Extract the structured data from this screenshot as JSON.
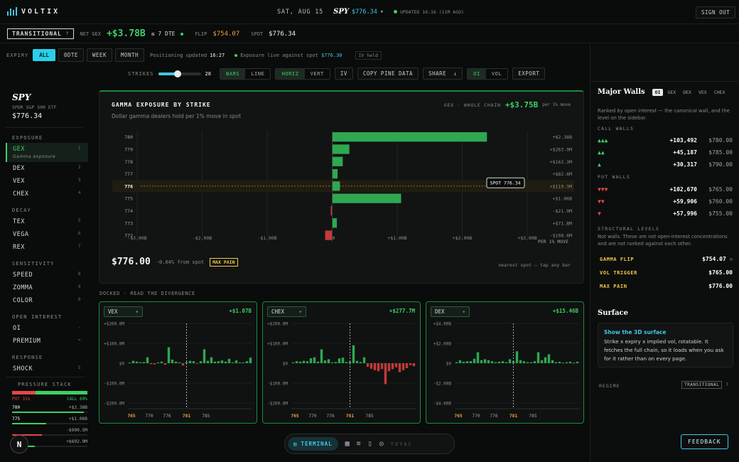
{
  "header": {
    "brand": "VOLTIX",
    "date": "SAT, AUG 15",
    "ticker": "SPY",
    "price": "$776.34",
    "updated": "UPDATED 16:16 (11M AGO)",
    "signout": "SIGN OUT"
  },
  "statusbar": {
    "regime": "TRANSITIONAL",
    "regime_help": "?",
    "netgex_label": "NET GEX",
    "netgex_value": "+$3.78B",
    "dte": "≤ 7 DTE",
    "flip_label": "FLIP",
    "flip_value": "$754.07",
    "spot_label": "SPOT",
    "spot_value": "$776.34"
  },
  "expiry": {
    "label": "EXPIRY",
    "options": [
      "ALL",
      "0DTE",
      "WEEK",
      "MONTH"
    ],
    "selected": "ALL",
    "positioning_label": "Positioning updated",
    "positioning_time": "16:27",
    "exposure_label": "Exposure live against spot",
    "exposure_spot": "$776.30",
    "iv_held": "IV held"
  },
  "toolbar": {
    "strikes_label": "STRIKES",
    "strikes_value": "28",
    "slider_fraction": 0.45,
    "bars": "BARS",
    "line": "LINE",
    "horiz": "HORIZ",
    "vert": "VERT",
    "iv": "IV",
    "copy": "COPY PINE DATA",
    "share": "SHARE",
    "share_arrow": "↓",
    "oi": "OI",
    "vol": "VOL",
    "export": "EXPORT"
  },
  "sidebar": {
    "ticker": "SPY",
    "name": "SPDR S&P 500 ETF",
    "price": "$776.34",
    "sections": [
      {
        "title": "EXPOSURE",
        "items": [
          {
            "label": "GEX",
            "key": "1",
            "sub": "Gamma exposure",
            "active": true
          },
          {
            "label": "DEX",
            "key": "2"
          },
          {
            "label": "VEX",
            "key": "3"
          },
          {
            "label": "CHEX",
            "key": "4"
          }
        ]
      },
      {
        "title": "DECAY",
        "items": [
          {
            "label": "TEX",
            "key": "5"
          },
          {
            "label": "VEGA",
            "key": "6"
          },
          {
            "label": "REX",
            "key": "7"
          }
        ]
      },
      {
        "title": "SENSITIVITY",
        "items": [
          {
            "label": "SPEED",
            "key": "8"
          },
          {
            "label": "ZOMMA",
            "key": "9"
          },
          {
            "label": "COLOR",
            "key": "0"
          }
        ]
      },
      {
        "title": "OPEN INTEREST",
        "items": [
          {
            "label": "OI",
            "key": "-"
          },
          {
            "label": "PREMIUM",
            "key": "="
          }
        ]
      },
      {
        "title": "RESPONSE",
        "items": [
          {
            "label": "SHOCK",
            "key": "S"
          }
        ]
      }
    ],
    "pressure": {
      "title": "PRESSURE STACK",
      "put": "PUT 31%",
      "call": "CALL 69%",
      "put_fraction": 0.31,
      "rows": [
        {
          "strike": "780",
          "value": "+$2.38B",
          "fill": 0.95,
          "color": "#3ecf65"
        },
        {
          "strike": "775",
          "value": "+$1.06B",
          "fill": 0.45,
          "color": "#3ecf65"
        },
        {
          "strike": "",
          "value": "-$990.5M",
          "fill": 0.4,
          "color": "#e24848"
        },
        {
          "strike": "",
          "value": "+$692.9M",
          "fill": 0.3,
          "color": "#3ecf65"
        }
      ]
    }
  },
  "gex_chart": {
    "title": "GAMMA EXPOSURE BY STRIKE",
    "subtitle": "Dollar gamma dealers hold per 1% move in spot",
    "total_label": "GEX · WHOLE CHAIN",
    "total_value": "+$3.75B",
    "total_unit": "per 1% move",
    "spot_tag": "SPOT 776.34",
    "xunit": "PER 1% MOVE",
    "spot_price": "$776.00",
    "spot_diff": "-0.04% from spot",
    "maxpain": "MAX PAIN",
    "hint": "nearest spot — tap any bar"
  },
  "chart_data": [
    {
      "type": "bar",
      "title": "GAMMA EXPOSURE BY STRIKE",
      "orientation": "horizontal",
      "categories": [
        "780",
        "779",
        "778",
        "777",
        "776",
        "775",
        "774",
        "773",
        "772"
      ],
      "values": [
        2.38,
        0.2639,
        0.1623,
        0.0826,
        0.1193,
        1.06,
        -0.0219,
        0.0718,
        -0.1086
      ],
      "value_labels": [
        "+$2.38B",
        "+$263.9M",
        "+$162.3M",
        "+$82.6M",
        "+$119.3M",
        "+$1.06B",
        "-$21.9M",
        "+$71.8M",
        "-$108.6M"
      ],
      "xticks": [
        "-$3.00B",
        "-$2.00B",
        "-$1.00B",
        "$0",
        "+$1.00B",
        "+$2.00B",
        "+$3.00B"
      ],
      "xlim": [
        -3,
        3
      ],
      "spot_category": "776"
    },
    {
      "type": "bar",
      "title": "VEX",
      "total": "+$1.07B",
      "yticks": [
        "+$200.0M",
        "+$100.0M",
        "$0",
        "-$100.0M",
        "-$200.0M"
      ],
      "ylim": [
        -200,
        200
      ],
      "xticks": [
        "765",
        "770",
        "776",
        "781",
        "785"
      ],
      "values": [
        3,
        12,
        8,
        5,
        6,
        30,
        -5,
        -6,
        4,
        8,
        -8,
        80,
        18,
        8,
        4,
        -12,
        6,
        12,
        10,
        -3,
        10,
        70,
        12,
        30,
        8,
        10,
        14,
        8,
        22,
        4,
        14,
        4,
        4,
        10,
        28
      ]
    },
    {
      "type": "bar",
      "title": "CHEX",
      "total": "+$277.7M",
      "yticks": [
        "+$200.0M",
        "+$100.0M",
        "$0",
        "-$100.0M",
        "-$200.0M"
      ],
      "ylim": [
        -200,
        200
      ],
      "xticks": [
        "765",
        "770",
        "776",
        "781",
        "785"
      ],
      "values": [
        4,
        10,
        8,
        12,
        10,
        25,
        30,
        8,
        70,
        14,
        20,
        4,
        6,
        24,
        28,
        6,
        8,
        90,
        12,
        6,
        30,
        -18,
        -28,
        -35,
        -40,
        -30,
        -105,
        -40,
        -30,
        -20,
        -45,
        -35,
        -25,
        -10,
        -15
      ]
    },
    {
      "type": "bar",
      "title": "DEX",
      "total": "+$15.46B",
      "yticks": [
        "+$4.00B",
        "+$2.00B",
        "$0",
        "-$2.00B",
        "-$4.00B"
      ],
      "ylim": [
        -4,
        4
      ],
      "xticks": [
        "765",
        "770",
        "776",
        "781",
        "785"
      ],
      "values": [
        0.1,
        0.3,
        0.15,
        0.2,
        0.2,
        0.45,
        1.1,
        0.3,
        0.4,
        0.3,
        0.2,
        0.1,
        0.15,
        0.2,
        0.1,
        0.4,
        0.2,
        1.2,
        0.3,
        0.2,
        0.1,
        0.1,
        0.2,
        1.1,
        0.3,
        0.6,
        0.9,
        0.3,
        0.1,
        0.15,
        0.05,
        0.1,
        0.15,
        0.05,
        0.15
      ]
    }
  ],
  "docked": {
    "title": "DOCKED · READ THE DIVERGENCE"
  },
  "rightpanel": {
    "title": "Major Walls",
    "tabs": [
      "OI",
      "GEX",
      "DEX",
      "VEX",
      "CHEX"
    ],
    "desc": "Ranked by open interest — the canonical wall, and the level on the sidebar.",
    "call_title": "CALL WALLS",
    "calls": [
      {
        "tri": "▲▲▲",
        "oi": "+103,492",
        "price": "$780.00"
      },
      {
        "tri": "▲▲",
        "oi": "+45,187",
        "price": "$785.00"
      },
      {
        "tri": "▲",
        "oi": "+30,317",
        "price": "$790.00"
      }
    ],
    "put_title": "PUT WALLS",
    "puts": [
      {
        "tri": "▼▼▼",
        "oi": "+102,670",
        "price": "$765.00"
      },
      {
        "tri": "▼▼",
        "oi": "+59,906",
        "price": "$760.00"
      },
      {
        "tri": "▼",
        "oi": "+57,996",
        "price": "$755.00"
      }
    ],
    "structural_title": "STRUCTURAL LEVELS",
    "structural_desc": "Not walls. These are not open-interest concentrations and are not ranked against each other.",
    "levels": [
      {
        "label": "GAMMA FLIP",
        "value": "$754.07"
      },
      {
        "label": "VOL TRIGGER",
        "value": "$765.00"
      },
      {
        "label": "MAX PAIN",
        "value": "$776.00"
      }
    ],
    "surface_title": "Surface",
    "surface_link": "Show the 3D surface",
    "surface_desc": "Strike x expiry x implied vol, rotatable. It fetches the full chain, so it loads when you ask for it rather than on every page.",
    "regime_label": "REGIME",
    "regime_value": "TRANSITIONAL",
    "regime_help": "?",
    "feedback": "FEEDBACK"
  },
  "dock": {
    "terminal": "TERMINAL",
    "toyac": "TOYAC",
    "avatar": "N"
  },
  "colors": {
    "accent": "#3fc9e0",
    "green": "#3ecf65",
    "red": "#e24848",
    "yellow": "#f4c84a"
  }
}
